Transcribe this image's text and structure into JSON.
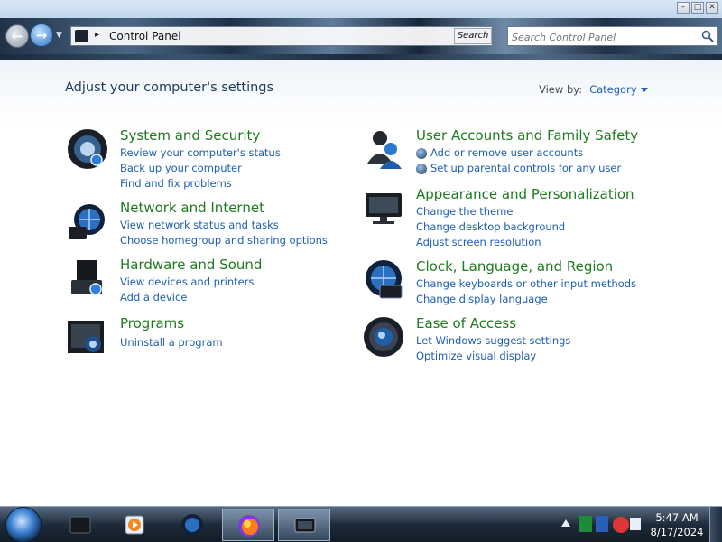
{
  "window": {
    "caption_buttons": [
      "minimize-icon",
      "maximize-icon",
      "close-icon"
    ]
  },
  "nav": {
    "address": "Control Panel",
    "search_button": "Search",
    "search_placeholder": "Search Control Panel"
  },
  "header": {
    "title": "Adjust your computer's settings",
    "view_by_label": "View by:",
    "view_by_value": "Category"
  },
  "categories": [
    {
      "title": "System and Security",
      "icon": "shield-icon",
      "links": [
        "Review your computer's status",
        "Back up your computer",
        "Find and fix problems"
      ]
    },
    {
      "title": "Network and Internet",
      "icon": "globe-network-icon",
      "links": [
        "View network status and tasks",
        "Choose homegroup and sharing options"
      ]
    },
    {
      "title": "Hardware and Sound",
      "icon": "printer-icon",
      "links": [
        "View devices and printers",
        "Add a device"
      ]
    },
    {
      "title": "Programs",
      "icon": "programs-icon",
      "links": [
        "Uninstall a program"
      ]
    },
    {
      "title": "User Accounts and Family Safety",
      "icon": "users-icon",
      "links": [
        "Add or remove user accounts",
        "Set up parental controls for any user"
      ]
    },
    {
      "title": "Appearance and Personalization",
      "icon": "monitor-icon",
      "links": [
        "Change the theme",
        "Change desktop background",
        "Adjust screen resolution"
      ]
    },
    {
      "title": "Clock, Language, and Region",
      "icon": "clock-globe-icon",
      "links": [
        "Change keyboards or other input methods",
        "Change display language"
      ]
    },
    {
      "title": "Ease of Access",
      "icon": "ease-of-access-icon",
      "links": [
        "Let Windows suggest settings",
        "Optimize visual display"
      ]
    }
  ],
  "taskbar": {
    "items": [
      "file-explorer-icon",
      "media-player-icon",
      "globe-icon",
      "firefox-icon",
      "control-panel-icon"
    ],
    "clock_time": "5:47 AM",
    "clock_date": "8/17/2024"
  },
  "colors": {
    "category_title": "#1e7a1e",
    "link": "#1e5eb3",
    "heading": "#1e395b"
  }
}
